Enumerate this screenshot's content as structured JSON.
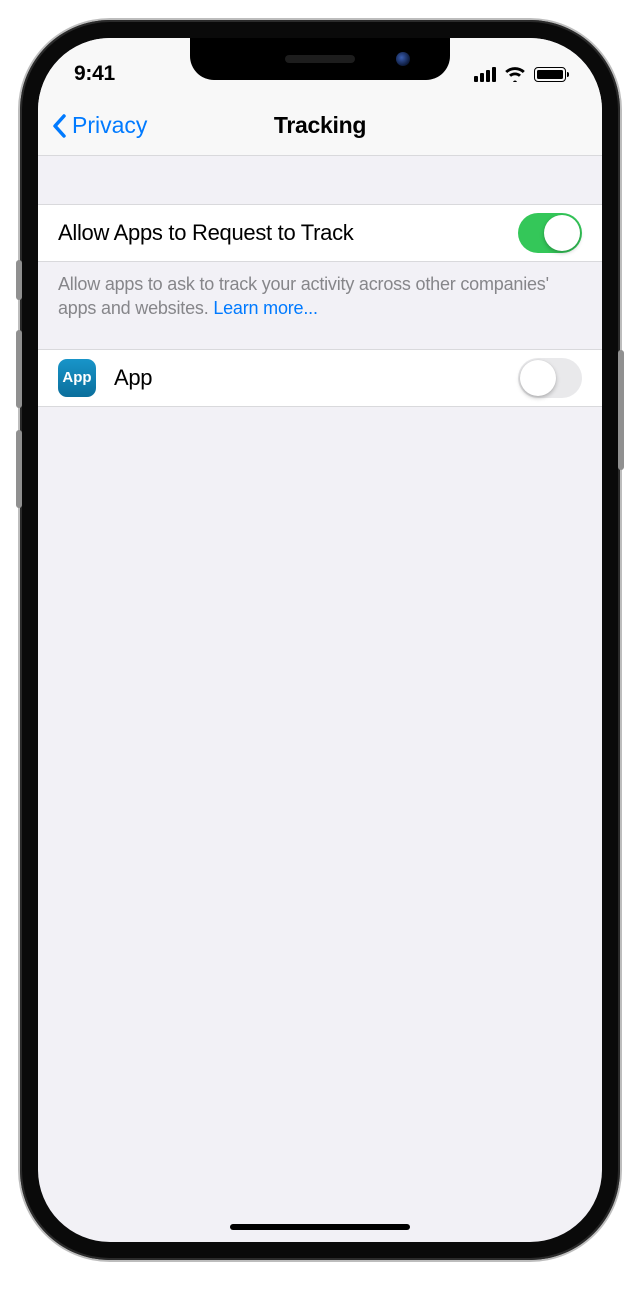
{
  "status": {
    "time": "9:41"
  },
  "nav": {
    "back_label": "Privacy",
    "title": "Tracking"
  },
  "settings": {
    "allow_tracking": {
      "label": "Allow Apps to Request to Track",
      "enabled": true
    },
    "footer_text": "Allow apps to ask to track your activity across other companies' apps and websites. ",
    "learn_more": "Learn more...",
    "apps": [
      {
        "icon_text": "App",
        "name": "App",
        "enabled": false
      }
    ]
  }
}
